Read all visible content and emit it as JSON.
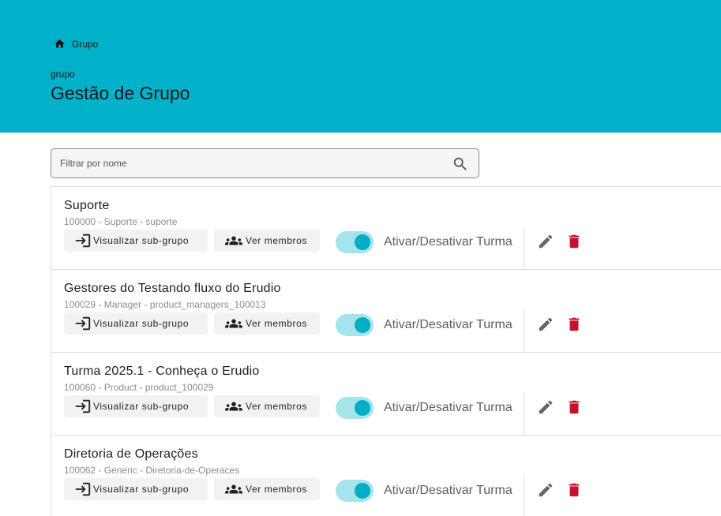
{
  "breadcrumb": {
    "label": "Grupo"
  },
  "header": {
    "subtitle": "grupo",
    "title": "Gestão de Grupo"
  },
  "search": {
    "placeholder": "Filtrar por nome",
    "value": ""
  },
  "colors": {
    "header_bg": "#00b1c9",
    "toggle_on": "#00afc5",
    "delete": "#c8102e"
  },
  "groups": [
    {
      "name": "Suporte",
      "meta": "100000 - Suporte - suporte",
      "sub_group_label": "Visualizar sub-grupo",
      "members_label": "Ver membros",
      "toggle_label": "Ativar/Desativar Turma",
      "active": true
    },
    {
      "name": "Gestores do Testando fluxo do Erudio",
      "meta": "100029 - Manager - product_managers_100013",
      "sub_group_label": "Visualizar sub-grupo",
      "members_label": "Ver membros",
      "toggle_label": "Ativar/Desativar Turma",
      "active": true
    },
    {
      "name": "Turma 2025.1 - Conheça o Erudio",
      "meta": "100060 - Product - product_100029",
      "sub_group_label": "Visualizar sub-grupo",
      "members_label": "Ver membros",
      "toggle_label": "Ativar/Desativar Turma",
      "active": true
    },
    {
      "name": "Diretoria de Operações",
      "meta": "100062 - Generic - Diretoria-de-Operaces",
      "sub_group_label": "Visualizar sub-grupo",
      "members_label": "Ver membros",
      "toggle_label": "Ativar/Desativar Turma",
      "active": true
    }
  ]
}
